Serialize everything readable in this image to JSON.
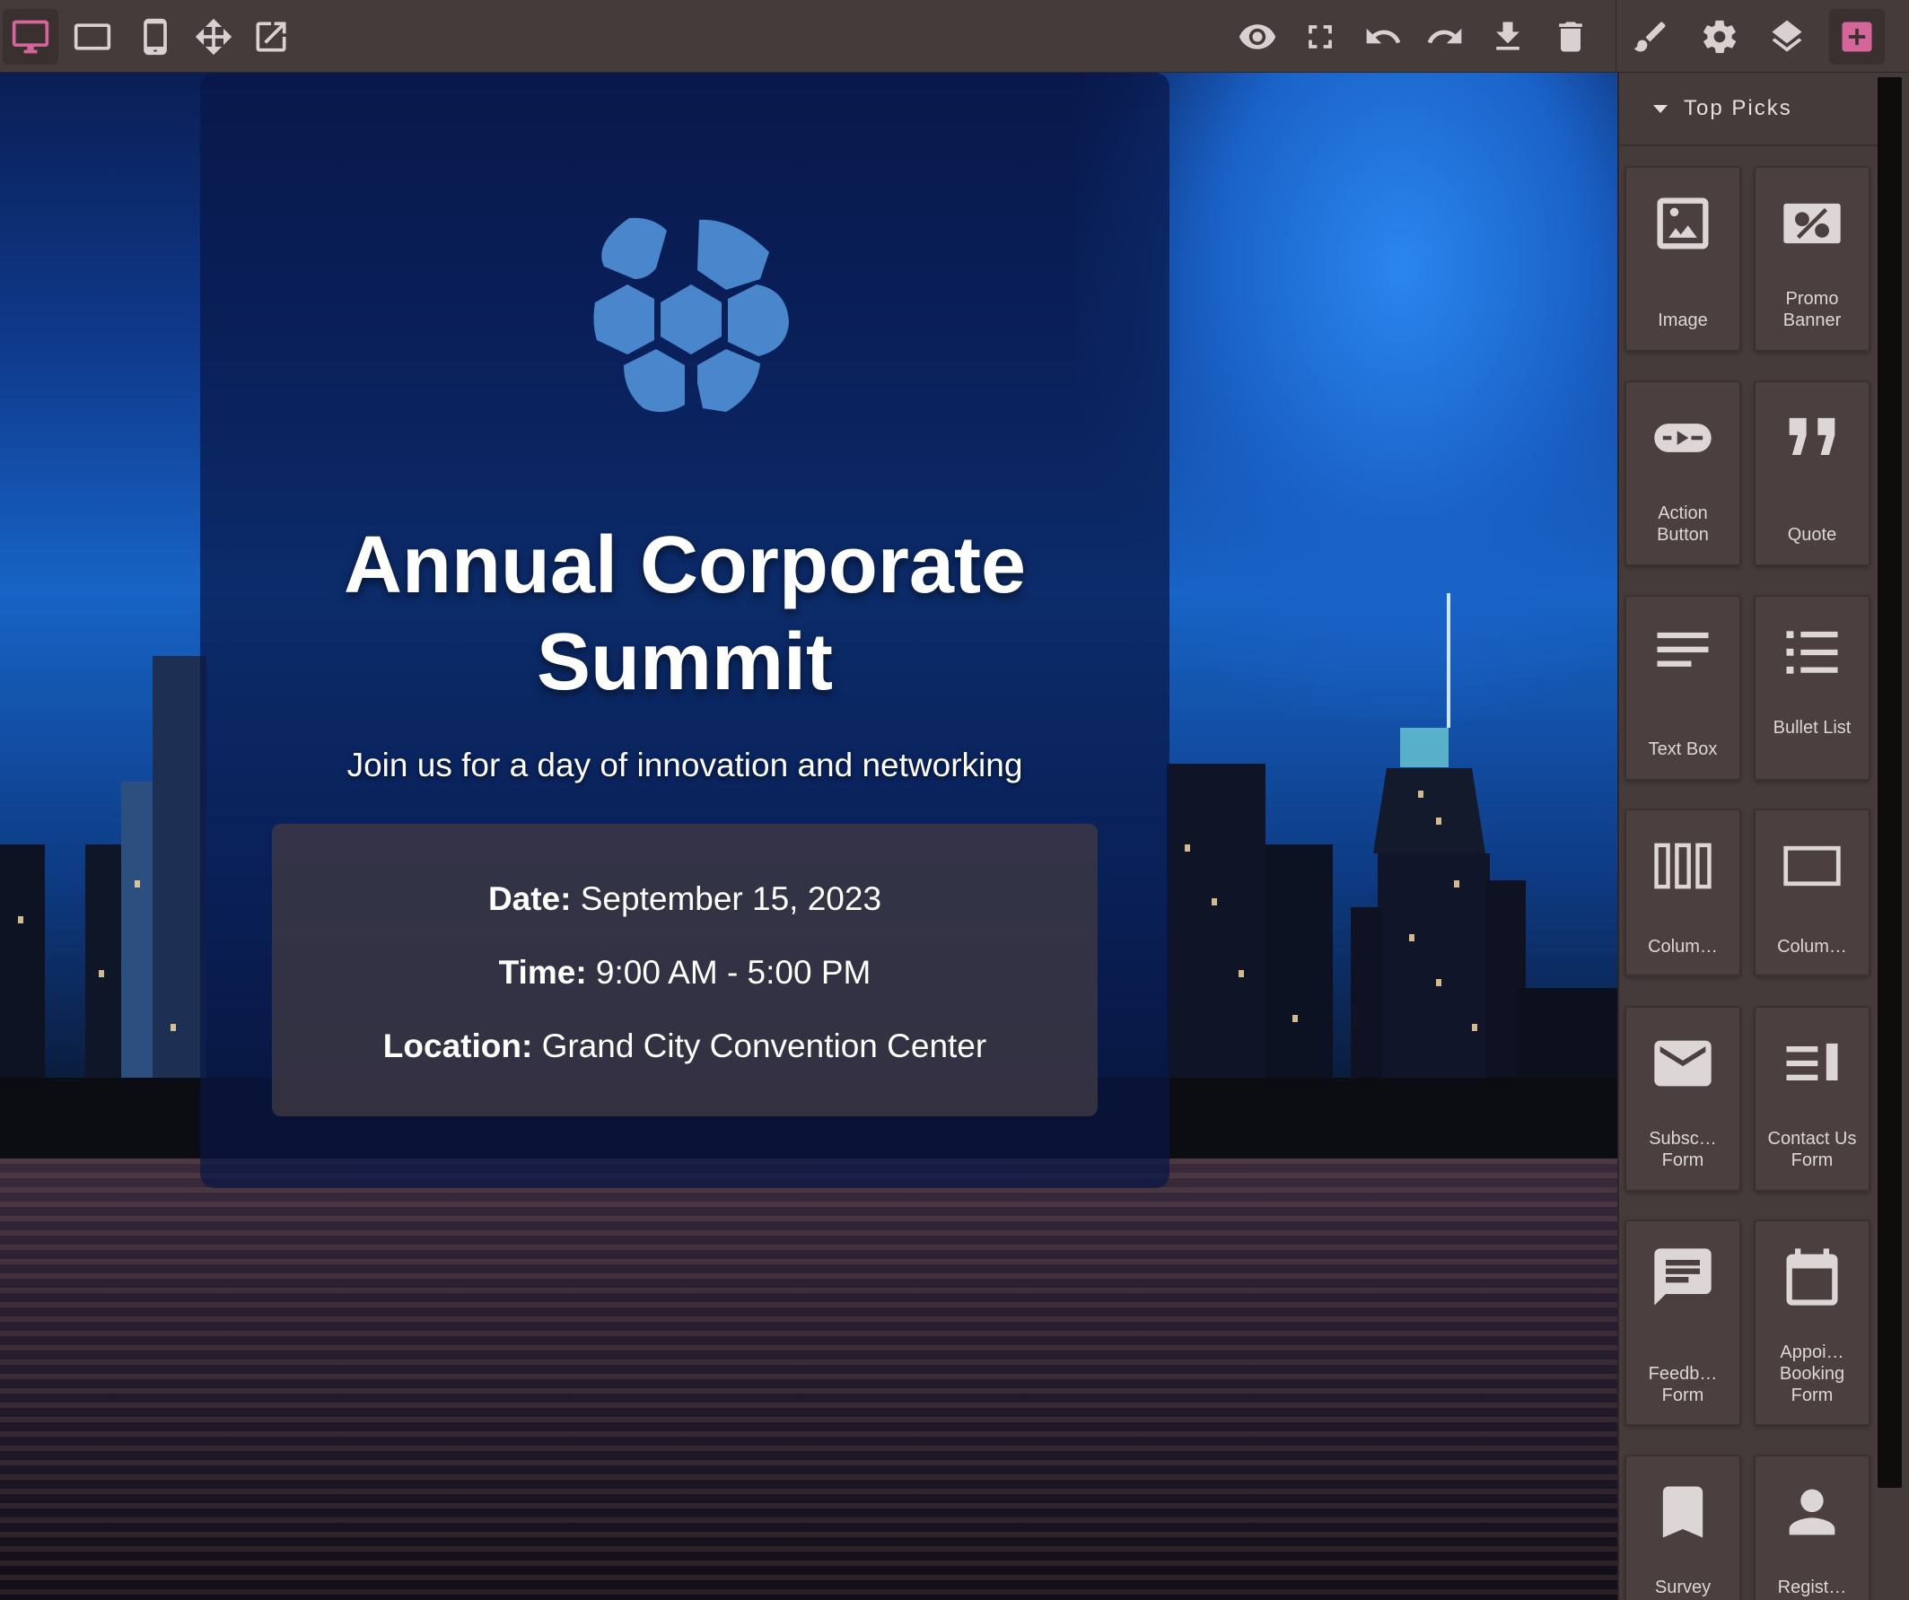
{
  "toolbar": {
    "left": [
      {
        "name": "desktop-view-button",
        "icon": "desktop-icon",
        "active": true
      },
      {
        "name": "tablet-view-button",
        "icon": "tablet-landscape-icon"
      },
      {
        "name": "mobile-view-button",
        "icon": "mobile-icon"
      },
      {
        "name": "move-button",
        "icon": "move-arrows-icon"
      },
      {
        "name": "open-external-button",
        "icon": "external-link-icon"
      }
    ],
    "right": [
      {
        "name": "preview-button",
        "icon": "eye-icon"
      },
      {
        "name": "fullscreen-button",
        "icon": "fullscreen-icon"
      },
      {
        "name": "undo-button",
        "icon": "undo-icon"
      },
      {
        "name": "redo-button",
        "icon": "redo-icon"
      },
      {
        "name": "download-button",
        "icon": "download-icon"
      },
      {
        "name": "delete-button",
        "icon": "trash-icon"
      },
      {
        "name": "style-manager-button",
        "icon": "paintbrush-icon"
      },
      {
        "name": "settings-button",
        "icon": "gear-icon"
      },
      {
        "name": "layers-button",
        "icon": "layers-icon"
      },
      {
        "name": "add-block-button",
        "icon": "plus-square-icon",
        "active": true
      }
    ],
    "accent_color": "#d4669a",
    "icon_color": "#d9d1d1"
  },
  "event": {
    "title_line1": "Annual Corporate",
    "title_line2": "Summit",
    "subtitle": "Join us for a day of innovation and networking",
    "date_label": "Date:",
    "date_value": "September 15, 2023",
    "time_label": "Time:",
    "time_value": "9:00 AM - 5:00 PM",
    "location_label": "Location:",
    "location_value": "Grand City Convention Center",
    "logo_color": "#4a86cc",
    "logo_icon": "honeycomb-logo-icon"
  },
  "panel": {
    "title": "Top Picks",
    "blocks": [
      {
        "name": "image",
        "label": "Image",
        "icon": "image-icon"
      },
      {
        "name": "promo-banner",
        "label": "Promo Banner",
        "icon": "percent-tag-icon"
      },
      {
        "name": "action-button",
        "label": "Action Button",
        "icon": "button-pill-icon"
      },
      {
        "name": "quote",
        "label": "Quote",
        "icon": "quote-icon"
      },
      {
        "name": "text-box",
        "label": "Text Box",
        "icon": "text-lines-icon"
      },
      {
        "name": "bullet-list",
        "label": "Bullet List",
        "icon": "list-icon"
      },
      {
        "name": "columns-3",
        "label": "Colum…",
        "icon": "three-columns-icon"
      },
      {
        "name": "columns-1",
        "label": "Colum…",
        "icon": "one-column-icon"
      },
      {
        "name": "subscribe-form",
        "label": "Subsc… Form",
        "icon": "envelope-icon"
      },
      {
        "name": "contact-us-form",
        "label": "Contact Us Form",
        "icon": "form-lines-icon"
      },
      {
        "name": "feedback-form",
        "label": "Feedb… Form",
        "icon": "comment-icon"
      },
      {
        "name": "appointment-booking-form",
        "label": "Appoi… Booking Form",
        "icon": "calendar-icon"
      },
      {
        "name": "survey",
        "label": "Survey",
        "icon": "bookmark-icon"
      },
      {
        "name": "registration",
        "label": "Regist…",
        "icon": "user-icon"
      }
    ]
  }
}
